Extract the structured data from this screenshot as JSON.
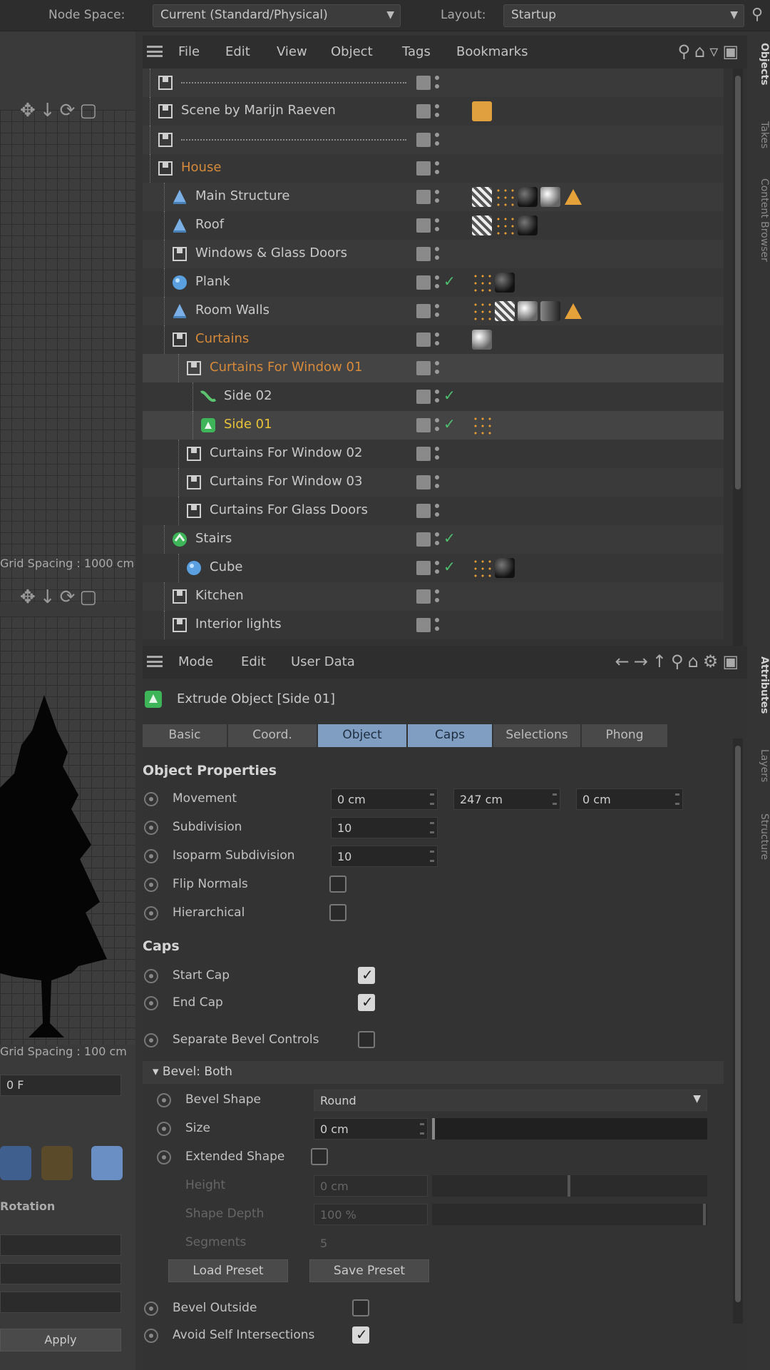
{
  "topbar": {
    "node_space_label": "Node Space:",
    "node_space_value": "Current (Standard/Physical)",
    "layout_label": "Layout:",
    "layout_value": "Startup"
  },
  "viewport": {
    "top_grid_spacing": "Grid Spacing : 1000 cm",
    "bottom_grid_spacing": "Grid Spacing : 100 cm",
    "frame_field": "0 F",
    "section_label": "Rotation",
    "apply_button": "Apply"
  },
  "object_manager": {
    "menu": [
      "File",
      "Edit",
      "View",
      "Object",
      "Tags",
      "Bookmarks"
    ],
    "rows": [
      {
        "name": "",
        "sep": true
      },
      {
        "name": "Scene by Marijn Raeven"
      },
      {
        "name": "",
        "sep": true
      },
      {
        "name": "House"
      },
      {
        "name": "Main Structure"
      },
      {
        "name": "Roof"
      },
      {
        "name": "Windows & Glass Doors"
      },
      {
        "name": "Plank"
      },
      {
        "name": "Room Walls"
      },
      {
        "name": "Curtains"
      },
      {
        "name": "Curtains For Window 01"
      },
      {
        "name": "Side 02"
      },
      {
        "name": "Side 01"
      },
      {
        "name": "Curtains For Window 02"
      },
      {
        "name": "Curtains For Window 03"
      },
      {
        "name": "Curtains For Glass Doors"
      },
      {
        "name": "Stairs"
      },
      {
        "name": "Cube"
      },
      {
        "name": "Kitchen"
      },
      {
        "name": "Interior lights"
      }
    ]
  },
  "side_tabs": {
    "objects": "Objects",
    "takes": "Takes",
    "content_browser": "Content Browser",
    "attributes": "Attributes",
    "layers": "Layers",
    "structure": "Structure"
  },
  "attributes": {
    "menu": [
      "Mode",
      "Edit",
      "User Data"
    ],
    "title": "Extrude Object [Side 01]",
    "tabs": [
      "Basic",
      "Coord.",
      "Object",
      "Caps",
      "Selections",
      "Phong"
    ],
    "object_properties_heading": "Object Properties",
    "movement_label": "Movement",
    "movement_x": "0 cm",
    "movement_y": "247 cm",
    "movement_z": "0 cm",
    "subdivision_label": "Subdivision",
    "subdivision_value": "10",
    "isoparm_label": "Isoparm Subdivision",
    "isoparm_value": "10",
    "flip_normals_label": "Flip Normals",
    "hierarchical_label": "Hierarchical",
    "caps_heading": "Caps",
    "start_cap_label": "Start Cap",
    "end_cap_label": "End Cap",
    "separate_bevel_label": "Separate Bevel Controls",
    "bevel_both_label": "▾ Bevel: Both",
    "bevel_shape_label": "Bevel Shape",
    "bevel_shape_value": "Round",
    "size_label": "Size",
    "size_value": "0 cm",
    "extended_shape_label": "Extended Shape",
    "height_label": "Height",
    "height_value": "0 cm",
    "shape_depth_label": "Shape Depth",
    "shape_depth_value": "100 %",
    "segments_label": "Segments",
    "segments_value": "5",
    "load_preset": "Load Preset",
    "save_preset": "Save Preset",
    "bevel_outside_label": "Bevel Outside",
    "avoid_self_label": "Avoid Self Intersections"
  },
  "colors": {
    "accent_tab": "#7f9ec2",
    "orange_text": "#d68a3a",
    "yellow_text": "#e8c33a",
    "green_check": "#4fbf6e"
  }
}
